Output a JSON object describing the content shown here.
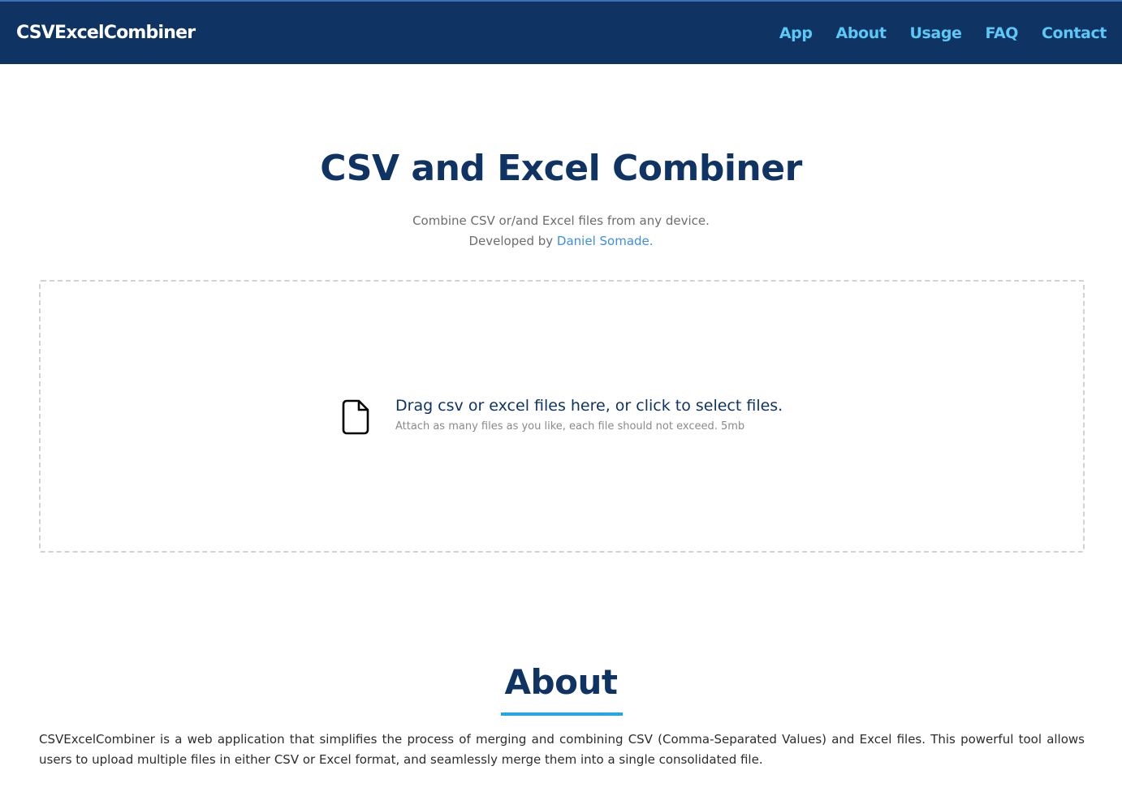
{
  "navbar": {
    "brand": "CSVExcelCombiner",
    "links": [
      "App",
      "About",
      "Usage",
      "FAQ",
      "Contact"
    ]
  },
  "hero": {
    "title": "CSV and Excel Combiner",
    "subtitle": "Combine CSV or/and Excel files from any device.",
    "developed_by": "Developed by",
    "developer_name": "Daniel Somade."
  },
  "dropzone": {
    "icon": "file-icon",
    "main_text": "Drag csv or excel files here, or click to select files.",
    "sub_text": "Attach as many files as you like, each file should not exceed. 5mb"
  },
  "about": {
    "title": "About",
    "text": "CSVExcelCombiner is a web application that simplifies the process of merging and combining CSV (Comma-Separated Values) and Excel files. This powerful tool allows users to upload multiple files in either CSV or Excel format, and seamlessly merge them into a single consolidated file."
  },
  "colors": {
    "navbar_bg": "#0f3464",
    "nav_link": "#5bc8f5",
    "accent": "#23a5ea",
    "link": "#3d8ee5"
  }
}
